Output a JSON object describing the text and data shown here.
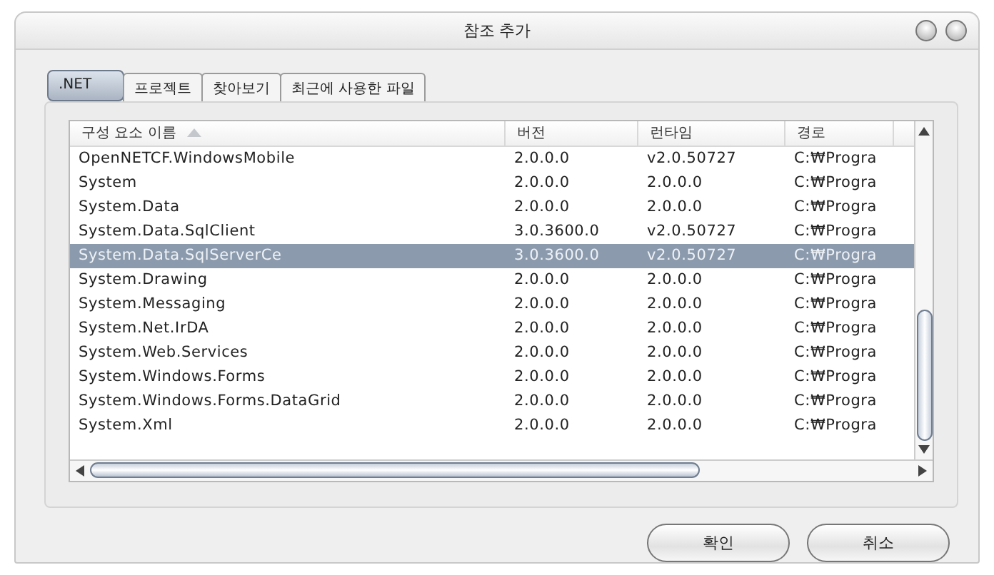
{
  "window": {
    "title": "참조 추가"
  },
  "tabs": [
    {
      "label": ".NET",
      "selected": true
    },
    {
      "label": "프로젝트",
      "selected": false
    },
    {
      "label": "찾아보기",
      "selected": false
    },
    {
      "label": "최근에 사용한 파일",
      "selected": false
    }
  ],
  "table": {
    "columns": [
      "구성 요소 이름",
      "버전",
      "런타임",
      "경로"
    ],
    "rows": [
      {
        "cells": [
          "OpenNETCF.WindowsMobile",
          "2.0.0.0",
          "v2.0.50727",
          "C:₩Progra"
        ],
        "selected": false
      },
      {
        "cells": [
          "System",
          "2.0.0.0",
          "2.0.0.0",
          "C:₩Progra"
        ],
        "selected": false
      },
      {
        "cells": [
          "System.Data",
          "2.0.0.0",
          "2.0.0.0",
          "C:₩Progra"
        ],
        "selected": false
      },
      {
        "cells": [
          "System.Data.SqlClient",
          "3.0.3600.0",
          "v2.0.50727",
          "C:₩Progra"
        ],
        "selected": false
      },
      {
        "cells": [
          "System.Data.SqlServerCe",
          "3.0.3600.0",
          "v2.0.50727",
          "C:₩Progra"
        ],
        "selected": true
      },
      {
        "cells": [
          "System.Drawing",
          "2.0.0.0",
          "2.0.0.0",
          "C:₩Progra"
        ],
        "selected": false
      },
      {
        "cells": [
          "System.Messaging",
          "2.0.0.0",
          "2.0.0.0",
          "C:₩Progra"
        ],
        "selected": false
      },
      {
        "cells": [
          "System.Net.IrDA",
          "2.0.0.0",
          "2.0.0.0",
          "C:₩Progra"
        ],
        "selected": false
      },
      {
        "cells": [
          "System.Web.Services",
          "2.0.0.0",
          "2.0.0.0",
          "C:₩Progra"
        ],
        "selected": false
      },
      {
        "cells": [
          "System.Windows.Forms",
          "2.0.0.0",
          "2.0.0.0",
          "C:₩Progra"
        ],
        "selected": false
      },
      {
        "cells": [
          "System.Windows.Forms.DataGrid",
          "2.0.0.0",
          "2.0.0.0",
          "C:₩Progra"
        ],
        "selected": false
      },
      {
        "cells": [
          "System.Xml",
          "2.0.0.0",
          "2.0.0.0",
          "C:₩Progra"
        ],
        "selected": false
      }
    ]
  },
  "buttons": [
    "확인",
    "취소"
  ]
}
